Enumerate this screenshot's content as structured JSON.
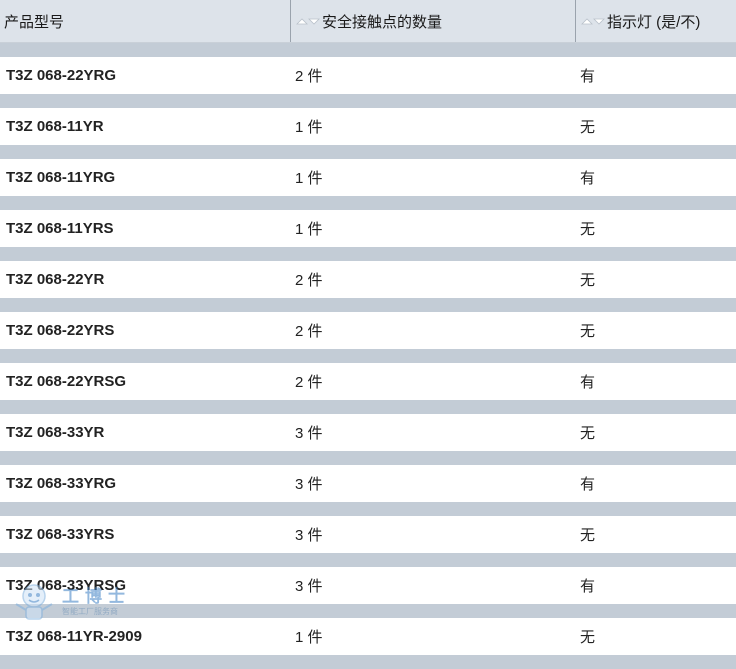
{
  "columns": [
    {
      "label": "产品型号",
      "sortable": false
    },
    {
      "label": "安全接触点的数量",
      "sortable": true
    },
    {
      "label": "指示灯 (是/不)",
      "sortable": true
    }
  ],
  "rows": [
    {
      "model": "T3Z 068-22YRG",
      "contacts": "2 件",
      "indicator": "有"
    },
    {
      "model": "T3Z 068-11YR",
      "contacts": "1 件",
      "indicator": "无"
    },
    {
      "model": "T3Z 068-11YRG",
      "contacts": "1 件",
      "indicator": "有"
    },
    {
      "model": "T3Z 068-11YRS",
      "contacts": "1 件",
      "indicator": "无"
    },
    {
      "model": "T3Z 068-22YR",
      "contacts": "2 件",
      "indicator": "无"
    },
    {
      "model": "T3Z 068-22YRS",
      "contacts": "2 件",
      "indicator": "无"
    },
    {
      "model": "T3Z 068-22YRSG",
      "contacts": "2 件",
      "indicator": "有"
    },
    {
      "model": "T3Z 068-33YR",
      "contacts": "3 件",
      "indicator": "无"
    },
    {
      "model": "T3Z 068-33YRG",
      "contacts": "3 件",
      "indicator": "有"
    },
    {
      "model": "T3Z 068-33YRS",
      "contacts": "3 件",
      "indicator": "无"
    },
    {
      "model": "T3Z 068-33YRSG",
      "contacts": "3 件",
      "indicator": "有"
    },
    {
      "model": "T3Z 068-11YR-2909",
      "contacts": "1 件",
      "indicator": "无"
    }
  ],
  "watermark": {
    "title": "工博士",
    "subtitle": "智能工厂服务商"
  },
  "colors": {
    "header_bg": "#dde3ea",
    "spacer_bg": "#c3ccd6",
    "row_bg": "#ffffff"
  }
}
